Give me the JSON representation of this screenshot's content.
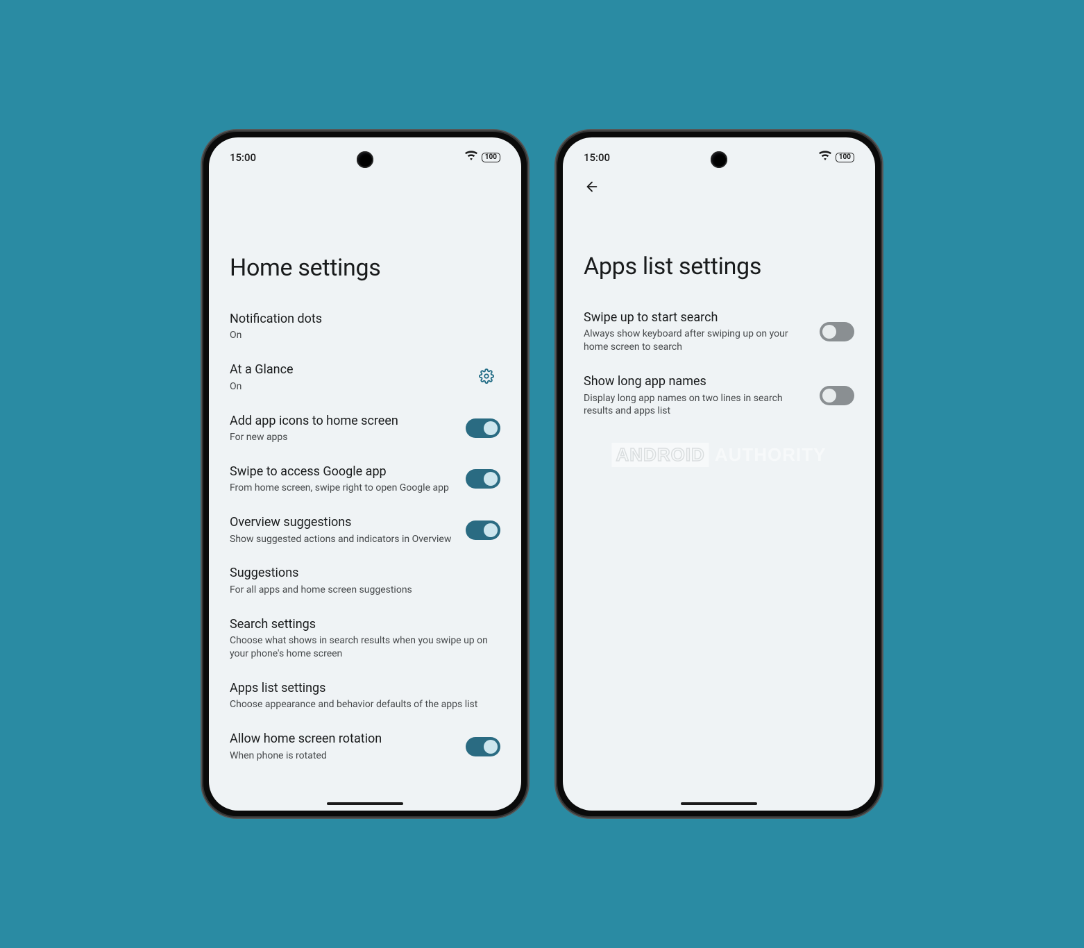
{
  "status": {
    "time": "15:00",
    "battery": "100"
  },
  "phone1": {
    "title": "Home settings",
    "items": [
      {
        "label": "Notification dots",
        "sub": "On",
        "type": "link"
      },
      {
        "label": "At a Glance",
        "sub": "On",
        "type": "gear"
      },
      {
        "label": "Add app icons to home screen",
        "sub": "For new apps",
        "type": "toggle",
        "on": true
      },
      {
        "label": "Swipe to access Google app",
        "sub": "From home screen, swipe right to open Google app",
        "type": "toggle",
        "on": true
      },
      {
        "label": "Overview suggestions",
        "sub": "Show suggested actions and indicators in Overview",
        "type": "toggle",
        "on": true
      },
      {
        "label": "Suggestions",
        "sub": "For all apps and home screen suggestions",
        "type": "link"
      },
      {
        "label": "Search settings",
        "sub": "Choose what shows in search results when you swipe up on your phone's home screen",
        "type": "link"
      },
      {
        "label": "Apps list settings",
        "sub": "Choose appearance and behavior defaults of the apps list",
        "type": "link"
      },
      {
        "label": "Allow home screen rotation",
        "sub": "When phone is rotated",
        "type": "toggle",
        "on": true
      }
    ]
  },
  "phone2": {
    "title": "Apps list settings",
    "items": [
      {
        "label": "Swipe up to start search",
        "sub": "Always show keyboard after swiping up on your home screen to search",
        "type": "toggle",
        "on": false
      },
      {
        "label": "Show long app names",
        "sub": "Display long app names on two lines in search results and apps list",
        "type": "toggle",
        "on": false
      }
    ]
  },
  "watermark": {
    "a": "ANDROID",
    "b": "AUTHORITY"
  }
}
